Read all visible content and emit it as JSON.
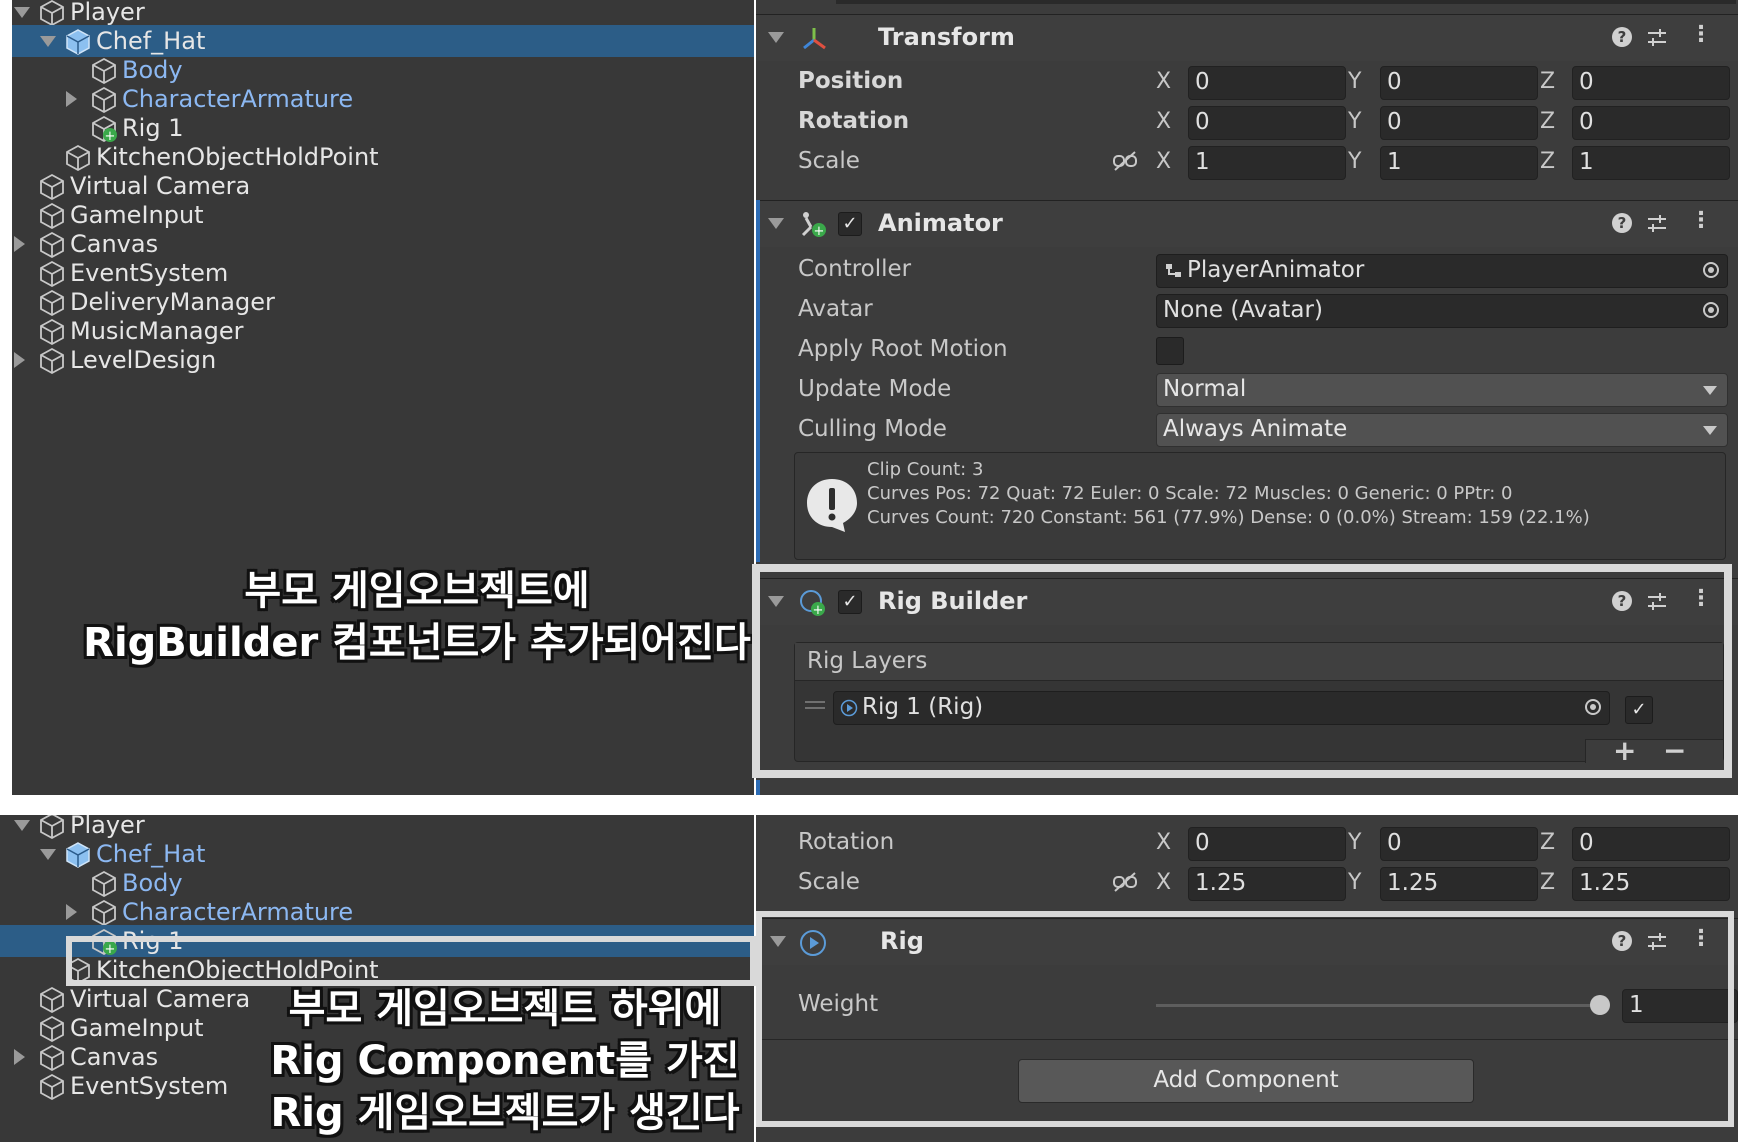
{
  "top": {
    "hierarchy": [
      {
        "label": "Player",
        "indent": 0,
        "arrow": "down",
        "color": "white",
        "selected": false,
        "icon": "cube-icon"
      },
      {
        "label": "Chef_Hat",
        "indent": 1,
        "arrow": "down",
        "color": "white",
        "selected": true,
        "icon": "prefab-cube-icon"
      },
      {
        "label": "Body",
        "indent": 2,
        "arrow": "",
        "color": "blue",
        "selected": false,
        "icon": "cube-icon"
      },
      {
        "label": "CharacterArmature",
        "indent": 2,
        "arrow": "right",
        "color": "blue",
        "selected": false,
        "icon": "cube-icon"
      },
      {
        "label": "Rig 1",
        "indent": 2,
        "arrow": "",
        "color": "white",
        "selected": false,
        "icon": "cube-plus-icon"
      },
      {
        "label": "KitchenObjectHoldPoint",
        "indent": 1,
        "arrow": "",
        "color": "white",
        "selected": false,
        "icon": "cube-icon"
      },
      {
        "label": "Virtual Camera",
        "indent": 0,
        "arrow": "",
        "color": "white",
        "selected": false,
        "icon": "cube-icon"
      },
      {
        "label": "GameInput",
        "indent": 0,
        "arrow": "",
        "color": "white",
        "selected": false,
        "icon": "cube-icon"
      },
      {
        "label": "Canvas",
        "indent": 0,
        "arrow": "right",
        "color": "white",
        "selected": false,
        "icon": "cube-icon"
      },
      {
        "label": "EventSystem",
        "indent": 0,
        "arrow": "",
        "color": "white",
        "selected": false,
        "icon": "cube-icon"
      },
      {
        "label": "DeliveryManager",
        "indent": 0,
        "arrow": "",
        "color": "white",
        "selected": false,
        "icon": "cube-icon"
      },
      {
        "label": "MusicManager",
        "indent": 0,
        "arrow": "",
        "color": "white",
        "selected": false,
        "icon": "cube-icon"
      },
      {
        "label": "LevelDesign",
        "indent": 0,
        "arrow": "right",
        "color": "white",
        "selected": false,
        "icon": "cube-icon"
      }
    ],
    "annotation_line1": "부모 게임오브젝트에",
    "annotation_line2": "RigBuilder 컴포넌트가 추가되어진다",
    "transform": {
      "title": "Transform",
      "position_label": "Position",
      "rotation_label": "Rotation",
      "scale_label": "Scale",
      "position": {
        "x": "0",
        "y": "0",
        "z": "0"
      },
      "rotation": {
        "x": "0",
        "y": "0",
        "z": "0"
      },
      "scale": {
        "x": "1",
        "y": "1",
        "z": "1"
      }
    },
    "axes": {
      "x": "X",
      "y": "Y",
      "z": "Z"
    },
    "animator": {
      "title": "Animator",
      "checkmark": "✓",
      "controller_label": "Controller",
      "controller_value": "PlayerAnimator",
      "avatar_label": "Avatar",
      "avatar_value": "None (Avatar)",
      "apply_root_motion_label": "Apply Root Motion",
      "update_mode_label": "Update Mode",
      "update_mode_value": "Normal",
      "culling_mode_label": "Culling Mode",
      "culling_mode_value": "Always Animate",
      "info_line1": "Clip Count: 3",
      "info_line2": "Curves Pos: 72 Quat: 72 Euler: 0 Scale: 72 Muscles: 0 Generic: 0 PPtr: 0",
      "info_line3": "Curves Count: 720 Constant: 561 (77.9%) Dense: 0 (0.0%) Stream: 159 (22.1%)"
    },
    "rig_builder": {
      "title": "Rig Builder",
      "checkmark": "✓",
      "rig_layers_label": "Rig Layers",
      "layer_value": "Rig 1 (Rig)",
      "layer_checkmark": "✓",
      "add_symbol": "+",
      "remove_symbol": "−"
    }
  },
  "bottom": {
    "hierarchy": [
      {
        "label": "Player",
        "indent": 0,
        "arrow": "down",
        "color": "white",
        "selected": false,
        "icon": "cube-icon"
      },
      {
        "label": "Chef_Hat",
        "indent": 1,
        "arrow": "down",
        "color": "blue",
        "selected": false,
        "icon": "prefab-cube-icon"
      },
      {
        "label": "Body",
        "indent": 2,
        "arrow": "",
        "color": "blue",
        "selected": false,
        "icon": "cube-icon"
      },
      {
        "label": "CharacterArmature",
        "indent": 2,
        "arrow": "right",
        "color": "blue",
        "selected": false,
        "icon": "cube-icon"
      },
      {
        "label": "Rig 1",
        "indent": 2,
        "arrow": "",
        "color": "white",
        "selected": true,
        "icon": "cube-plus-icon"
      },
      {
        "label": "KitchenObjectHoldPoint",
        "indent": 1,
        "arrow": "",
        "color": "white",
        "selected": false,
        "icon": "cube-icon"
      },
      {
        "label": "Virtual Camera",
        "indent": 0,
        "arrow": "",
        "color": "white",
        "selected": false,
        "icon": "cube-icon"
      },
      {
        "label": "GameInput",
        "indent": 0,
        "arrow": "",
        "color": "white",
        "selected": false,
        "icon": "cube-icon"
      },
      {
        "label": "Canvas",
        "indent": 0,
        "arrow": "right",
        "color": "white",
        "selected": false,
        "icon": "cube-icon"
      },
      {
        "label": "EventSystem",
        "indent": 0,
        "arrow": "",
        "color": "white",
        "selected": false,
        "icon": "cube-icon"
      }
    ],
    "annotation_line1": "부모 게임오브젝트 하위에",
    "annotation_line2": "Rig Component를 가진",
    "annotation_line3": "Rig 게임오브젝트가 생긴다",
    "transform": {
      "rotation_label": "Rotation",
      "scale_label": "Scale",
      "rotation": {
        "x": "0",
        "y": "0",
        "z": "0"
      },
      "scale": {
        "x": "1.25",
        "y": "1.25",
        "z": "1.25"
      }
    },
    "rig": {
      "title": "Rig",
      "weight_label": "Weight",
      "weight_value": "1",
      "weight_fraction": 1.0
    },
    "add_component_label": "Add Component"
  },
  "colors": {
    "selection": "#2c5d87",
    "highlight_frame": "#d9d9d9",
    "child_blue": "#8cb8f2",
    "panel_dark": "#383838"
  }
}
